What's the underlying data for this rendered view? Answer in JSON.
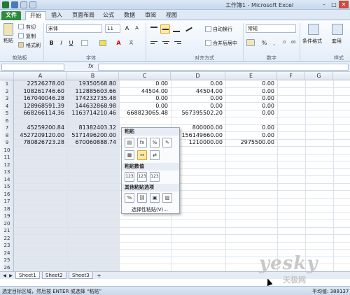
{
  "window": {
    "title": "工作簿1 - Microsoft Excel"
  },
  "tabs": [
    "文件",
    "开始",
    "插入",
    "页面布局",
    "公式",
    "数据",
    "审阅",
    "视图"
  ],
  "ribbon": {
    "clipboard": {
      "paste": "粘贴",
      "cut": "剪切",
      "copy": "复制",
      "format_painter": "格式刷",
      "group": "剪贴板"
    },
    "font": {
      "name": "宋体",
      "size": "11",
      "bold": "B",
      "italic": "I",
      "underline": "U",
      "group": "字体"
    },
    "alignment": {
      "wrap": "自动换行",
      "merge": "合并后居中",
      "group": "对齐方式"
    },
    "number": {
      "format": "常规",
      "percent": "%",
      "comma": ",",
      "group": "数字"
    },
    "styles": {
      "conditional": "条件格式",
      "apply": "套用",
      "group": "样式"
    }
  },
  "formula_bar": {
    "fx": "fx"
  },
  "columns": [
    "A",
    "B",
    "C",
    "D",
    "E",
    "F",
    "G"
  ],
  "rows": [
    "1",
    "2",
    "3",
    "4",
    "5",
    "6",
    "7",
    "8",
    "9",
    "10",
    "11",
    "12",
    "13",
    "14",
    "15",
    "16",
    "17",
    "18",
    "19",
    "20",
    "21",
    "22",
    "23",
    "24",
    "25",
    "26"
  ],
  "cells": {
    "r1": {
      "A": "22526278.00",
      "B": "19350568.80",
      "C": "0.00",
      "D": "0.00",
      "E": "0.00"
    },
    "r2": {
      "A": "108261746.60",
      "B": "112885603.66",
      "C": "44504.00",
      "D": "44504.00",
      "E": "0.00"
    },
    "r3": {
      "A": "167040046.28",
      "B": "174232735.48",
      "C": "0.00",
      "D": "0.00",
      "E": "0.00"
    },
    "r4": {
      "A": "128968591.39",
      "B": "144632868.98",
      "C": "0.00",
      "D": "0.00",
      "E": "0.00"
    },
    "r5": {
      "A": "668266114.36",
      "B": "1163714210.46",
      "C": "668823065.48",
      "D": "567395502.20",
      "E": "0.00"
    },
    "r7": {
      "A": "45259200.84",
      "B": "81382403.32",
      "D": "800000.00",
      "E": "0.00"
    },
    "r8": {
      "A": "4527209120.00",
      "B": "5171496200.00",
      "D": "156149660.00",
      "E": "0.00"
    },
    "r9": {
      "A": "780826723.28",
      "B": "670060888.74",
      "D": "1210000.00",
      "E": "2975500.00"
    }
  },
  "context_menu": {
    "paste_header": "粘贴",
    "paste_values_header": "粘贴数值",
    "other_header": "其他粘贴选项",
    "special": "选择性粘贴(V)...",
    "icons_row1": [
      "paste-icon",
      "formula-icon",
      "formula-number-format-icon",
      "keep-source-format-icon"
    ],
    "icons_row2": [
      "no-borders-icon",
      "keep-col-width-icon",
      "transpose-icon"
    ],
    "icons_values": [
      "values-icon",
      "values-number-format-icon",
      "values-source-format-icon"
    ],
    "icons_other": [
      "formatting-icon",
      "paste-link-icon",
      "picture-icon",
      "linked-picture-icon"
    ]
  },
  "sheets": [
    "Sheet1",
    "Sheet2",
    "Sheet3"
  ],
  "status": {
    "message": "选定目标区域，然后按 ENTER 或选择 “粘贴”",
    "average": "平均值: 388137"
  },
  "watermark": {
    "logo": "yesky",
    "text": "天极网"
  },
  "colors": {
    "file_tab": "#2e8b3a",
    "ribbon_bg": "#e4edf8",
    "selection": "#c8d2e1",
    "hover": "#fde9a9"
  }
}
